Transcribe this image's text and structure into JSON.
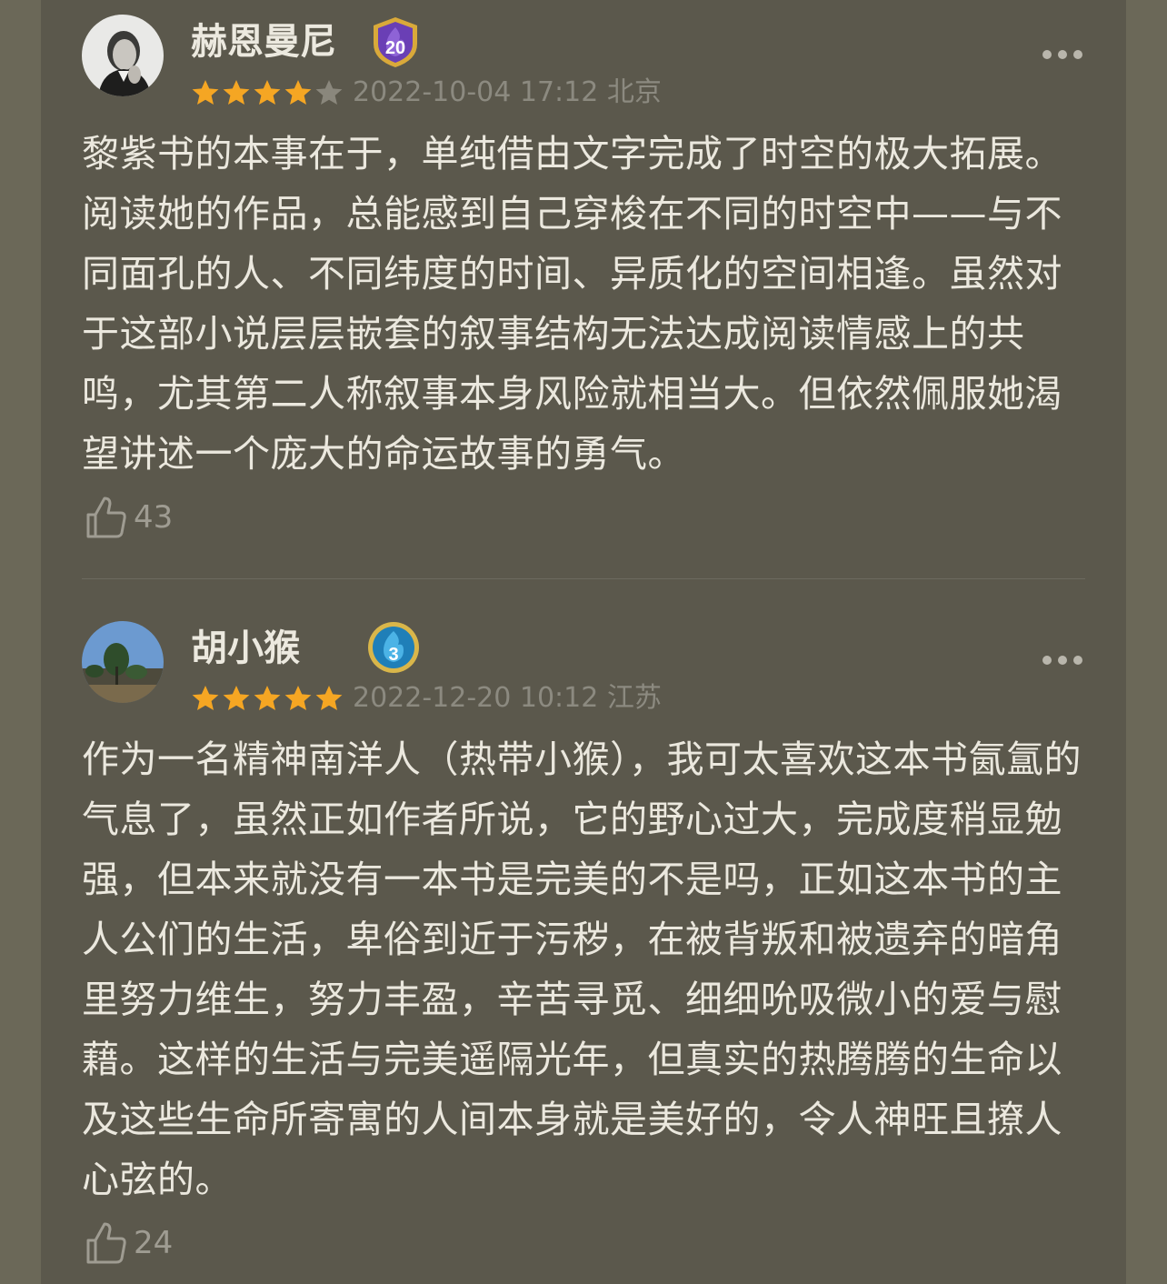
{
  "reviews": [
    {
      "username": "赫恩曼尼",
      "level": "20",
      "rating": 4,
      "meta": "2022-10-04 17:12 北京",
      "text": "黎紫书的本事在于，单纯借由文字完成了时空的极大拓展。阅读她的作品，总能感到自己穿梭在不同的时空中——与不同面孔的人、不同纬度的时间、异质化的空间相逢。虽然对于这部小说层层嵌套的叙事结构无法达成阅读情感上的共鸣，尤其第二人称叙事本身风险就相当大。但依然佩服她渴望讲述一个庞大的命运故事的勇气。",
      "likes": "43"
    },
    {
      "username": "胡小猴",
      "level": "3",
      "rating": 5,
      "meta": "2022-12-20 10:12 江苏",
      "text": "作为一名精神南洋人（热带小猴），我可太喜欢这本书氤氲的气息了，虽然正如作者所说，它的野心过大，完成度稍显勉强，但本来就没有一本书是完美的不是吗，正如这本书的主人公们的生活，卑俗到近于污秽，在被背叛和被遗弃的暗角里努力维生，努力丰盈，辛苦寻觅、细细吮吸微小的爱与慰藉。这样的生活与完美遥隔光年，但真实的热腾腾的生命以及这些生命所寄寓的人间本身就是美好的，令人神旺且撩人心弦的。",
      "likes": "24"
    }
  ],
  "colors": {
    "star_filled": "#f5a623",
    "star_empty": "#8a877c",
    "badge_purple": "#6a3fb5",
    "badge_blue": "#1f7fb8"
  }
}
